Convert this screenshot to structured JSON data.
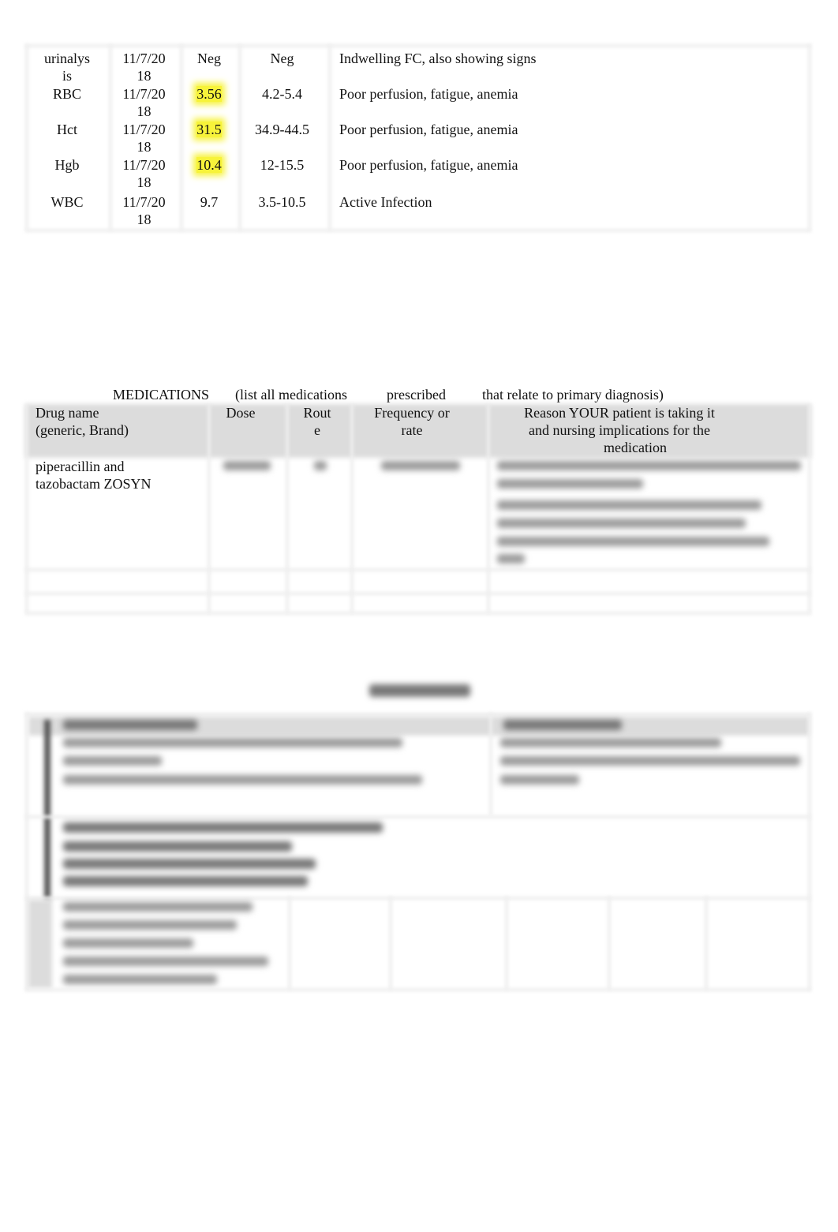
{
  "labs": {
    "rows": [
      {
        "test": [
          "urinalys",
          "is"
        ],
        "date": [
          "11/7/20",
          "18"
        ],
        "value": "Neg",
        "flag": false,
        "range": "Neg",
        "comment": "Indwelling FC, also showing signs"
      },
      {
        "test": [
          "RBC"
        ],
        "date": [
          "11/7/20",
          "18"
        ],
        "value": "3.56",
        "flag": true,
        "range": "4.2-5.4",
        "comment": "Poor perfusion, fatigue, anemia"
      },
      {
        "test": [
          "Hct"
        ],
        "date": [
          "11/7/20",
          "18"
        ],
        "value": "31.5",
        "flag": true,
        "range": "34.9-44.5",
        "comment": "Poor perfusion, fatigue, anemia"
      },
      {
        "test": [
          "Hgb"
        ],
        "date": [
          "11/7/20",
          "18"
        ],
        "value": "10.4",
        "flag": true,
        "range": "12-15.5",
        "comment": "Poor perfusion, fatigue, anemia"
      },
      {
        "test": [
          "WBC"
        ],
        "date": [
          "11/7/20",
          "18"
        ],
        "value": "9.7",
        "flag": false,
        "range": "3.5-10.5",
        "comment": "Active Infection"
      }
    ],
    "highlight_color": "#f7f33a"
  },
  "medications": {
    "title": [
      "MEDICATIONS",
      "(list all medications",
      "prescribed",
      "that relate to primary diagnosis)"
    ],
    "headers": {
      "drug": [
        "Drug name",
        "(generic, Brand)"
      ],
      "dose": [
        "Dose"
      ],
      "route": [
        "Rout",
        "e"
      ],
      "frequency": [
        "Frequency or",
        "rate"
      ],
      "reason": [
        "Reason YOUR patient is taking it",
        "and nursing implications for the",
        "medication"
      ]
    },
    "rows": [
      {
        "drug": [
          "piperacillin and",
          "tazobactam ZOSYN"
        ]
      }
    ]
  }
}
